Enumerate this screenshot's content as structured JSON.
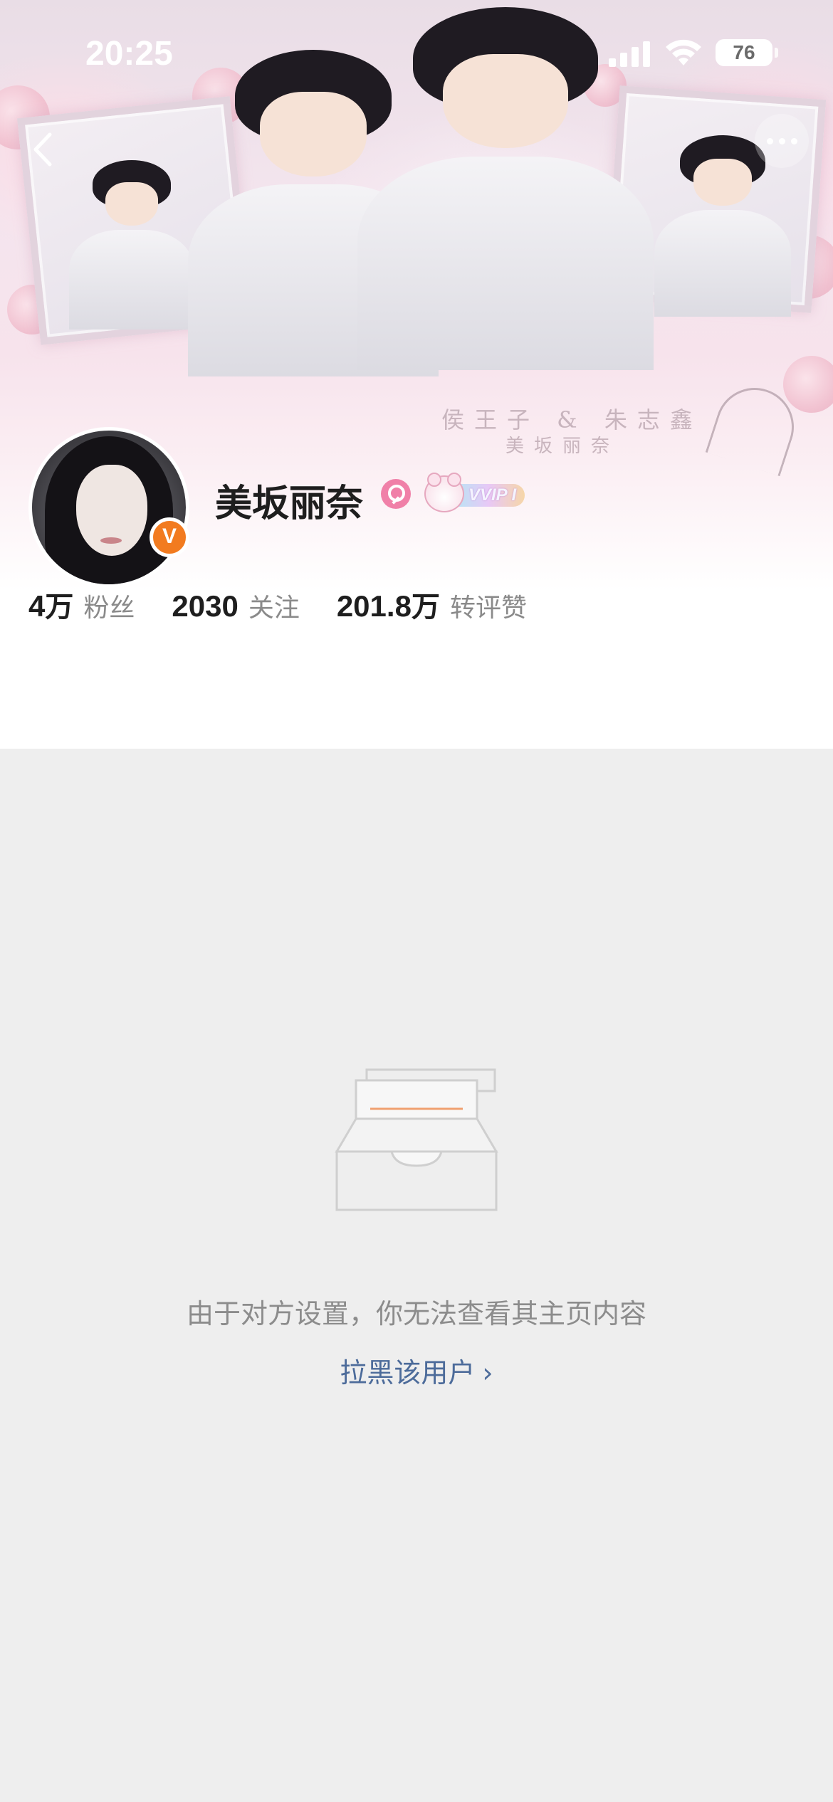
{
  "status_bar": {
    "time": "20:25",
    "battery": "76",
    "icons": [
      "signal-icon",
      "wifi-icon",
      "battery-icon"
    ]
  },
  "nav": {
    "back_icon": "chevron-left-icon",
    "more_icon": "more-horizontal-icon"
  },
  "banner": {
    "watermark_line1": "侯王子 & 朱志鑫",
    "watermark_line2": "美坂丽奈"
  },
  "profile": {
    "username": "美坂丽奈",
    "verified_badge": "V",
    "gender": "female",
    "vip_label": "VVIP I",
    "accent_color": "#f27b20"
  },
  "stats": [
    {
      "value": "4",
      "unit": "万",
      "label": "粉丝"
    },
    {
      "value": "2030",
      "unit": "",
      "label": "关注"
    },
    {
      "value": "201.8",
      "unit": "万",
      "label": "转评赞"
    }
  ],
  "empty_state": {
    "icon": "empty-inbox-icon",
    "message": "由于对方设置，你无法查看其主页内容",
    "action_label": "拉黑该用户",
    "action_chevron": "›",
    "link_color": "#4c6b9a"
  }
}
